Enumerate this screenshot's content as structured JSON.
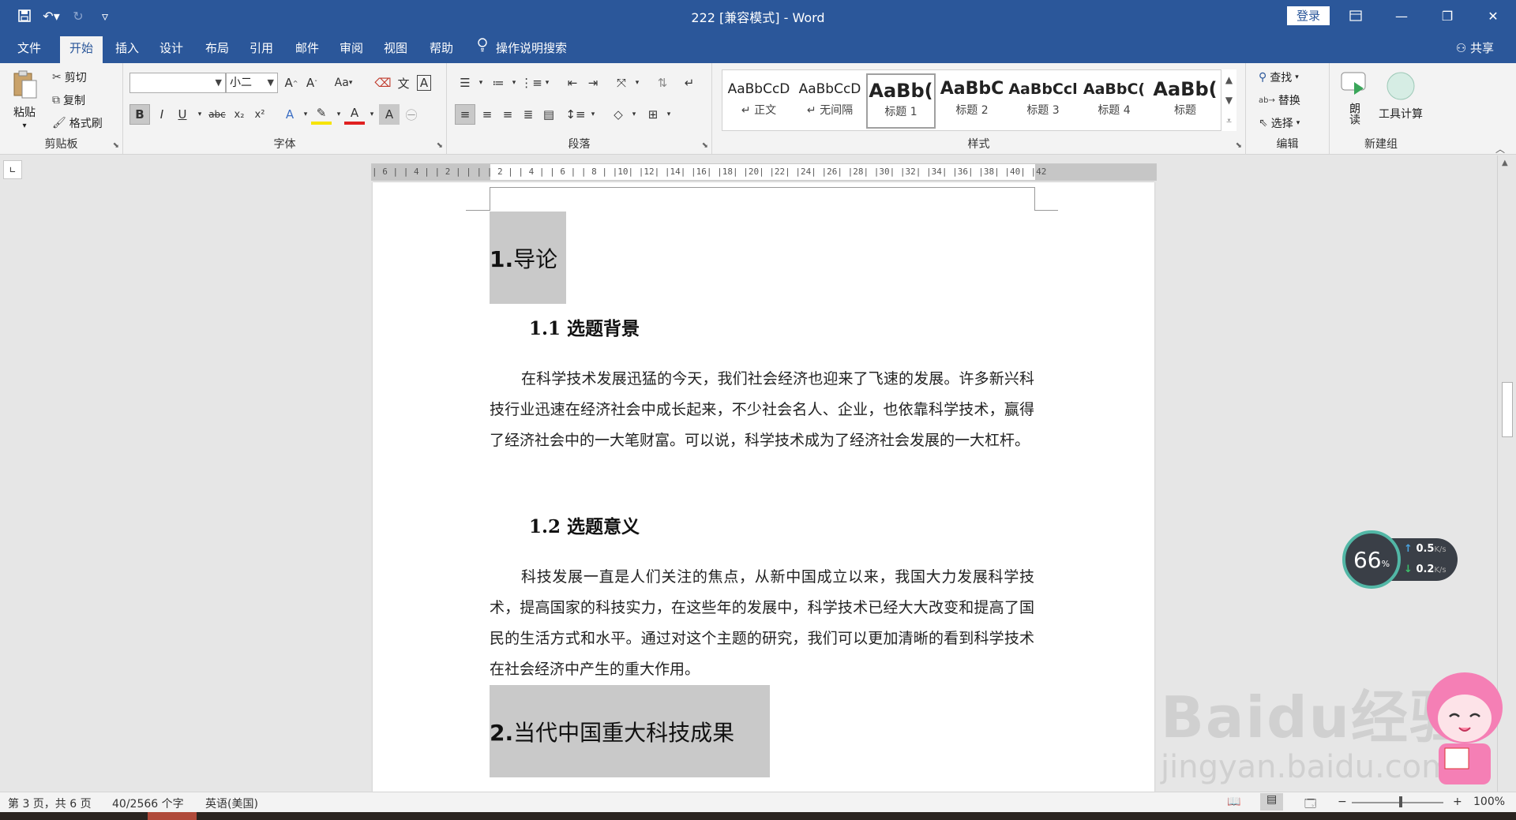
{
  "titlebar": {
    "title": "222 [兼容模式]  -  Word",
    "login": "登录"
  },
  "menu": {
    "tabs": [
      "文件",
      "开始",
      "插入",
      "设计",
      "布局",
      "引用",
      "邮件",
      "审阅",
      "视图",
      "帮助"
    ],
    "active_tab": "开始",
    "tell_me": "操作说明搜索",
    "share": "共享"
  },
  "ribbon": {
    "clipboard": {
      "label": "剪贴板",
      "paste": "粘贴",
      "cut": "剪切",
      "copy": "复制",
      "format_painter": "格式刷"
    },
    "font": {
      "label": "字体",
      "font_name": "",
      "font_size": "小二",
      "change_case": "Aa"
    },
    "paragraph": {
      "label": "段落"
    },
    "styles": {
      "label": "样式",
      "items": [
        {
          "sample": "AaBbCcD",
          "name": "↵ 正文"
        },
        {
          "sample": "AaBbCcD",
          "name": "↵ 无间隔"
        },
        {
          "sample": "AaBb(",
          "name": "标题 1"
        },
        {
          "sample": "AaBbC",
          "name": "标题 2"
        },
        {
          "sample": "AaBbCcl",
          "name": "标题 3"
        },
        {
          "sample": "AaBbC(",
          "name": "标题 4"
        },
        {
          "sample": "AaBb(",
          "name": "标题"
        }
      ]
    },
    "editing": {
      "label": "编辑",
      "find": "查找",
      "replace": "替换",
      "select": "选择"
    },
    "new_group": {
      "label": "新建组",
      "read_aloud": "朗读",
      "tool_calc": "工具计算"
    }
  },
  "ruler": {
    "numbers": "| 6 |  | 4 |  | 2 |  |  |  | 2 |  | 4 |  | 6 |  | 8 |  |10|  |12|  |14|  |16|  |18|  |20|  |22|  |24|  |26|  |28|  |30|  |32|  |34|  |36|  |38|  |40|  |42"
  },
  "document": {
    "h1_num": "1.",
    "h1_text": "导论",
    "h2_1": "1.1 选题背景",
    "p1": "在科学技术发展迅猛的今天，我们社会经济也迎来了飞速的发展。许多新兴科技行业迅速在经济社会中成长起来，不少社会名人、企业，也依靠科学技术，赢得了经济社会中的一大笔财富。可以说，科学技术成为了经济社会发展的一大杠杆。",
    "h2_2": "1.2 选题意义",
    "p2": "科技发展一直是人们关注的焦点，从新中国成立以来，我国大力发展科学技术，提高国家的科技实力，在这些年的发展中，科学技术已经大大改变和提高了国民的生活方式和水平。通过对这个主题的研究，我们可以更加清晰的看到科学技术在社会经济中产生的重大作用。",
    "h1b_num": "2.",
    "h1b_text": "当代中国重大科技成果"
  },
  "net_widget": {
    "percent": "66",
    "percent_unit": "%",
    "up": "0.5",
    "down": "0.2",
    "unit": "K/s"
  },
  "watermark": {
    "brand": "Baidu经验",
    "url": "jingyan.baidu.com"
  },
  "statusbar": {
    "page": "第 3 页，共 6 页",
    "words": "40/2566 个字",
    "language": "英语(美国)",
    "zoom": "100%"
  },
  "colors": {
    "word_blue": "#2b579a",
    "ribbon_bg": "#f3f3f3",
    "heading_highlight": "#c9c9c9"
  }
}
